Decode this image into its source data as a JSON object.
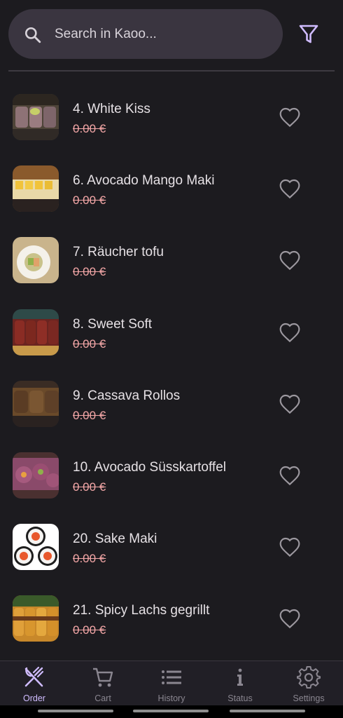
{
  "search": {
    "placeholder": "Search in Kaoo..."
  },
  "colors": {
    "accent": "#d0bcff",
    "background": "#1c1b1f",
    "price": "#f2a6a6",
    "search_bg": "#3a3540"
  },
  "items": [
    {
      "name": "4. White Kiss",
      "price": "0.00 €"
    },
    {
      "name": "6. Avocado Mango Maki",
      "price": "0.00 €"
    },
    {
      "name": "7. Räucher tofu",
      "price": "0.00 €"
    },
    {
      "name": "8. Sweet Soft",
      "price": "0.00 €"
    },
    {
      "name": "9. Cassava Rollos",
      "price": "0.00 €"
    },
    {
      "name": "10. Avocado Süsskartoffel",
      "price": "0.00 €"
    },
    {
      "name": "20. Sake Maki",
      "price": "0.00 €"
    },
    {
      "name": "21. Spicy Lachs gegrillt",
      "price": "0.00 €"
    }
  ],
  "nav": [
    {
      "label": "Order",
      "icon": "utensils-icon",
      "active": true
    },
    {
      "label": "Cart",
      "icon": "cart-icon",
      "active": false
    },
    {
      "label": "History",
      "icon": "list-icon",
      "active": false
    },
    {
      "label": "Status",
      "icon": "info-icon",
      "active": false
    },
    {
      "label": "Settings",
      "icon": "gear-icon",
      "active": false
    }
  ]
}
